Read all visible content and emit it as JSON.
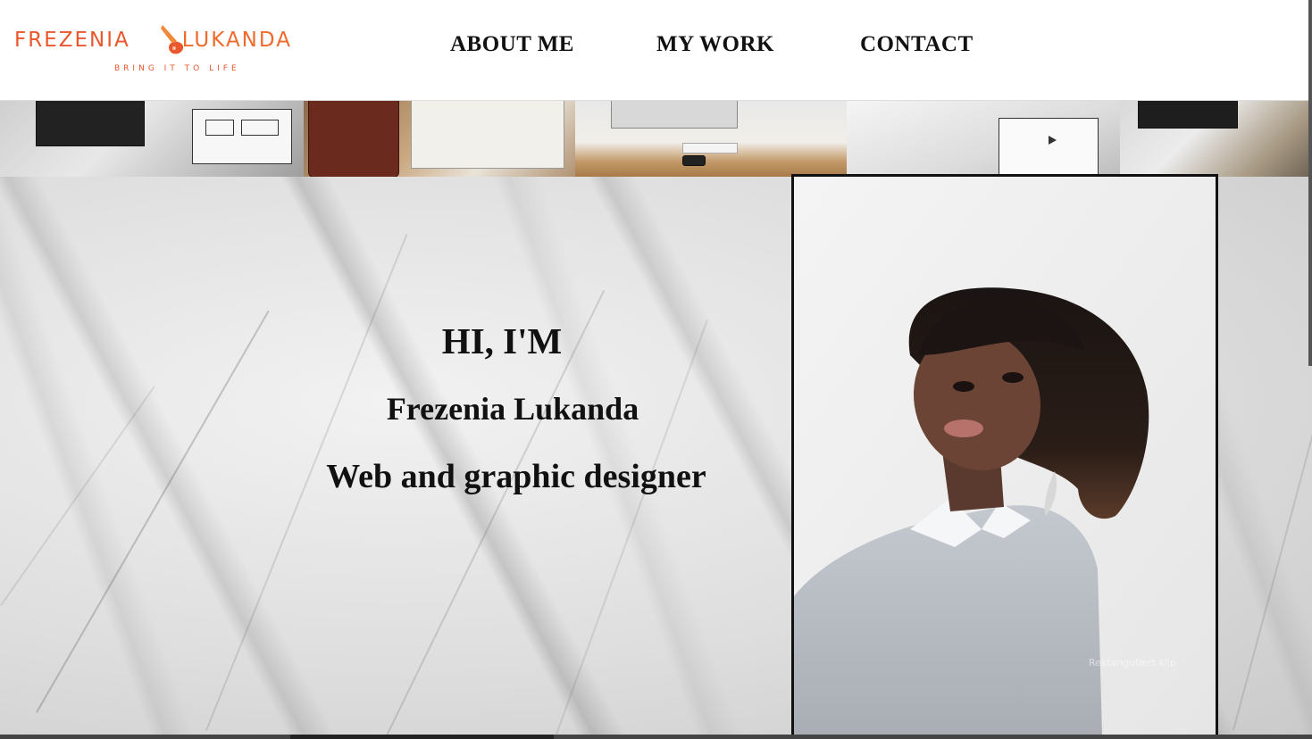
{
  "brand": {
    "first_name": "FREZENIA",
    "last_name": "LUKANDA",
    "tagline": "BRING IT TO LIFE",
    "color": "#e9572c",
    "icon": "pencil-hand-icon"
  },
  "nav": {
    "about": "ABOUT ME",
    "work": "MY WORK",
    "contact": "CONTACT"
  },
  "hero": {
    "greeting": "HI, I'M",
    "name": "Frezenia Lukanda",
    "role": "Web and graphic designer"
  },
  "portrait": {
    "overlay_label": "Rektangulært klip"
  }
}
